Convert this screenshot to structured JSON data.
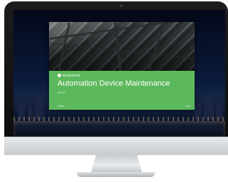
{
  "slide": {
    "logo_text": "RealCheck",
    "title": "Automation Device Maintenance",
    "subtitle": "SXXX",
    "footer_left": "Online",
    "footer_right": "SXX"
  },
  "colors": {
    "slide_green": "#5cb85c",
    "bezel": "#111112",
    "chin": "#d9dcdf"
  },
  "icons": [
    "camera-icon",
    "brand-logo-icon"
  ]
}
